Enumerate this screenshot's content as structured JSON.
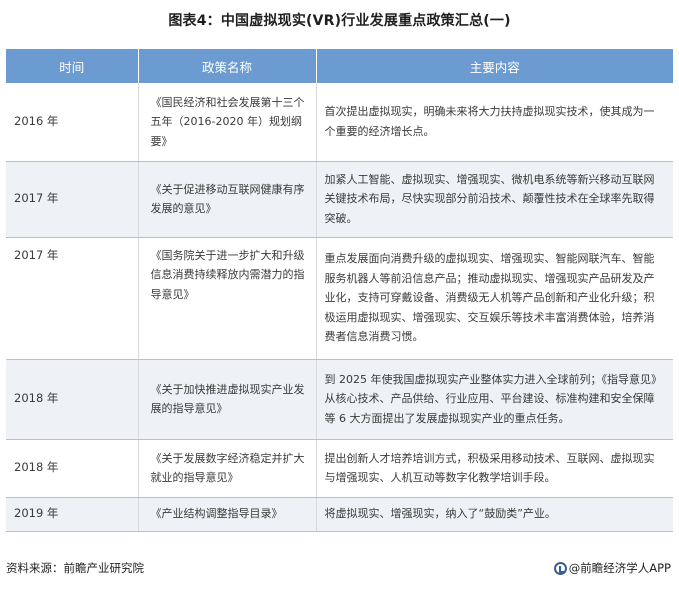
{
  "title": "图表4：中国虚拟现实(VR)行业发展重点政策汇总(一)",
  "table": {
    "headers": [
      "时间",
      "政策名称",
      "主要内容"
    ],
    "rows": [
      {
        "year": "2016 年",
        "policy": "《国民经济和社会发展第十三个五年（2016-2020 年）规划纲要》",
        "content": "首次提出虚拟现实，明确未来将大力扶持虚拟现实技术，使其成为一个重要的经济增长点。"
      },
      {
        "year": "2017 年",
        "policy": "《关于促进移动互联网健康有序发展的意见》",
        "content": "加紧人工智能、虚拟现实、增强现实、微机电系统等新兴移动互联网关键技术布局，尽快实现部分前沿技术、颠覆性技术在全球率先取得突破。"
      },
      {
        "year": "2017 年",
        "policy": "《国务院关于进一步扩大和升级信息消费持续释放内需潜力的指导意见》",
        "content": "重点发展面向消费升级的虚拟现实、增强现实、智能网联汽车、智能服务机器人等前沿信息产品；推动虚拟现实、增强现实产品研发及产业化，支持可穿戴设备、消费级无人机等产品创新和产业化升级；积极运用虚拟现实、增强现实、交互娱乐等技术丰富消费体验，培养消费者信息消费习惯。"
      },
      {
        "year": "2018 年",
        "policy": "《关于加快推进虚拟现实产业发展的指导意见》",
        "content": "到 2025 年使我国虚拟现实产业整体实力进入全球前列；《指导意见》从核心技术、产品供给、行业应用、平台建设、标准构建和安全保障等 6 大方面提出了发展虚拟现实产业的重点任务。"
      },
      {
        "year": "2018 年",
        "policy": "《关于发展数字经济稳定并扩大就业的指导意见》",
        "content": "提出创新人才培养培训方式，积极采用移动技术、互联网、虚拟现实与增强现实、人机互动等数字化教学培训手段。"
      },
      {
        "year": "2019 年",
        "policy": "《产业结构调整指导目录》",
        "content": "将虚拟现实、增强现实，纳入了“鼓励类”产业。"
      }
    ]
  },
  "footer": {
    "source": "资料来源：前瞻产业研究院",
    "brand": "@前瞻经济学人APP"
  }
}
